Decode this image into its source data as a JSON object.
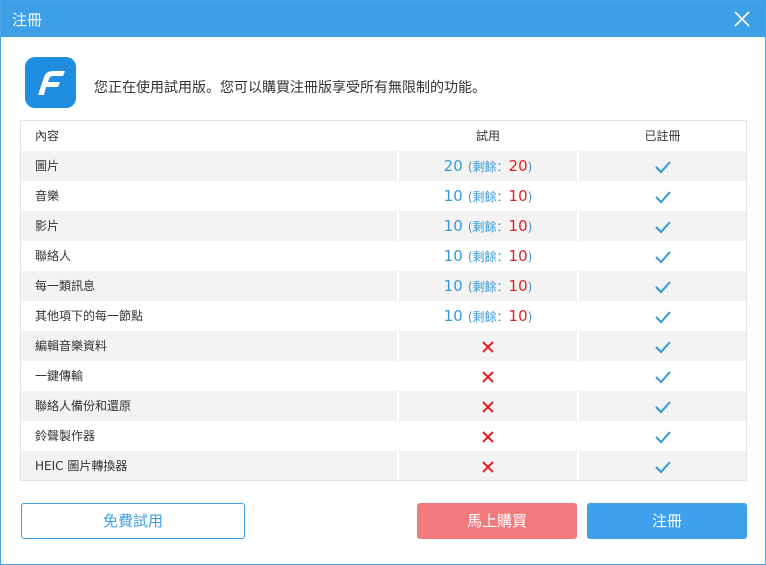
{
  "window": {
    "title": "注冊",
    "intro_text": "您正在使用試用版。您可以購買注冊版享受所有無限制的功能。"
  },
  "table": {
    "headers": {
      "content": "內容",
      "trial": "試用",
      "registered": "已註冊"
    },
    "rows": [
      {
        "name": "圖片",
        "trial_total": "20",
        "trial_left": "20"
      },
      {
        "name": "音樂",
        "trial_total": "10",
        "trial_left": "10"
      },
      {
        "name": "影片",
        "trial_total": "10",
        "trial_left": "10"
      },
      {
        "name": "聯絡人",
        "trial_total": "10",
        "trial_left": "10"
      },
      {
        "name": "每一類訊息",
        "trial_total": "10",
        "trial_left": "10"
      },
      {
        "name": "其他項下的每一節點",
        "trial_total": "10",
        "trial_left": "10"
      },
      {
        "name": "編輯音樂資料"
      },
      {
        "name": "一鍵傳輸"
      },
      {
        "name": "聯絡人備份和還原"
      },
      {
        "name": "鈴聲製作器"
      },
      {
        "name": "HEIC 圖片轉換器"
      }
    ],
    "remaining_label": "剩餘：",
    "paren_open": "(",
    "paren_close": ")"
  },
  "buttons": {
    "free_trial": "免費試用",
    "buy_now": "馬上購買",
    "register": "注冊"
  },
  "colors": {
    "titlebar": "#3d9fe6",
    "accent_blue": "#3599d6",
    "red": "#e02222",
    "buy_button": "#f27a7d",
    "register_button": "#3fa0ec"
  },
  "icons": {
    "close": "close-icon",
    "logo": "app-logo",
    "check": "check-icon",
    "cross": "cross-icon"
  }
}
